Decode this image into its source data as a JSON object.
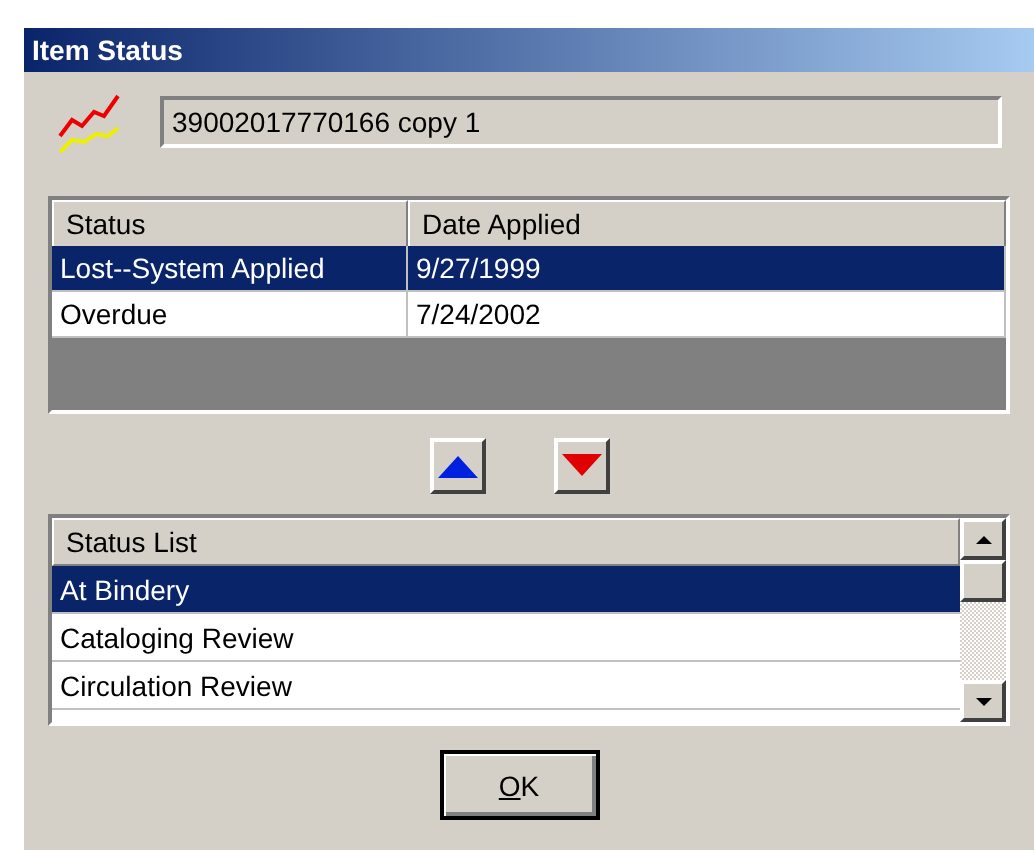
{
  "window": {
    "title": "Item Status"
  },
  "item": {
    "value": "39002017770166 copy 1"
  },
  "applied_table": {
    "columns": [
      "Status",
      "Date Applied"
    ],
    "rows": [
      {
        "cells": [
          "Lost--System Applied",
          "9/27/1999"
        ],
        "selected": true
      },
      {
        "cells": [
          "Overdue",
          "7/24/2002"
        ],
        "selected": false
      }
    ]
  },
  "status_list": {
    "header": "Status List",
    "items": [
      {
        "label": "At Bindery",
        "selected": true
      },
      {
        "label": "Cataloging Review",
        "selected": false
      },
      {
        "label": "Circulation Review",
        "selected": false
      }
    ]
  },
  "buttons": [
    {
      "label": "OK"
    }
  ]
}
